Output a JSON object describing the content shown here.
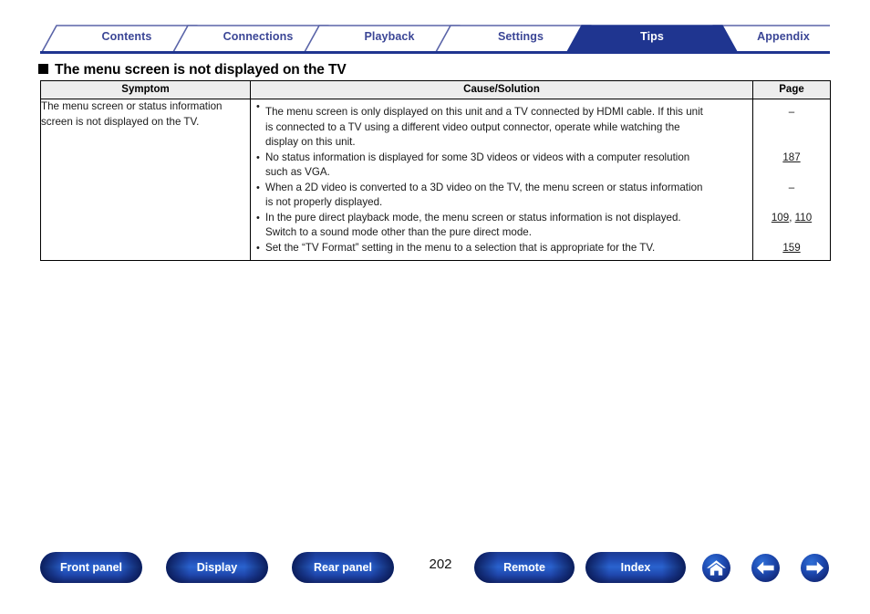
{
  "tabs": [
    {
      "label": "Contents",
      "active": false
    },
    {
      "label": "Connections",
      "active": false
    },
    {
      "label": "Playback",
      "active": false
    },
    {
      "label": "Settings",
      "active": false
    },
    {
      "label": "Tips",
      "active": true
    },
    {
      "label": "Appendix",
      "active": false
    }
  ],
  "heading": {
    "bullet": "black-square",
    "text": "The menu screen is not displayed on the TV"
  },
  "table": {
    "headers": {
      "symptom": "Symptom",
      "cause": "Cause/Solution",
      "page": "Page"
    },
    "symptom": "The menu screen or status information screen is not displayed on the TV.",
    "causes": [
      {
        "lines": [
          "The menu screen is only displayed on this unit and a TV connected by HDMI cable. If this unit",
          "is connected to a TV using a different video output connector, operate while watching the",
          "display on this unit."
        ],
        "page": "–",
        "page_link": false
      },
      {
        "lines": [
          "No status information is displayed for some 3D videos or videos with a computer resolution",
          "such as VGA."
        ],
        "page": "187",
        "page_link": true
      },
      {
        "lines": [
          "When a 2D video is converted to a 3D video on the TV, the menu screen or status information",
          "is not properly displayed."
        ],
        "page": "–",
        "page_link": false
      },
      {
        "lines": [
          "In the pure direct playback mode, the menu screen or status information is not displayed.",
          "Switch to a sound mode other than the pure direct mode."
        ],
        "page": "109, 110",
        "page_link": true,
        "page_parts": [
          "109",
          ", ",
          "110"
        ]
      },
      {
        "lines": [
          "Set the “TV Format” setting in the menu to a selection that is appropriate for the TV."
        ],
        "page": "159",
        "page_link": true
      }
    ]
  },
  "footer": {
    "buttons": [
      {
        "label": "Front panel"
      },
      {
        "label": "Display"
      },
      {
        "label": "Rear panel"
      },
      {
        "label": "Remote"
      },
      {
        "label": "Index"
      }
    ],
    "page_number": "202",
    "icons": [
      {
        "name": "home-icon"
      },
      {
        "name": "arrow-left-icon"
      },
      {
        "name": "arrow-right-icon"
      }
    ]
  },
  "colors": {
    "tab_active_bg": "#1f3590",
    "tab_text": "#3b4696",
    "tab_outline": "#5a64a8",
    "rule": "#1f3590",
    "header_bg": "#ededed",
    "button_blue": "#1f47ad"
  }
}
